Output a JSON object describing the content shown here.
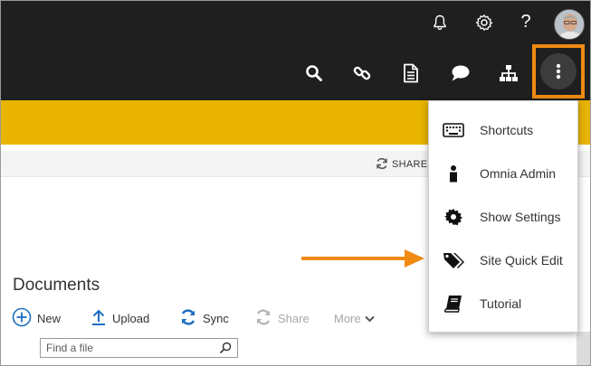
{
  "topbar": {
    "icons_row1": [
      "bell-icon",
      "gear-icon",
      "help-icon",
      "avatar"
    ],
    "help_glyph": "?",
    "icons_row2": [
      "search-icon",
      "link-icon",
      "document-icon",
      "chat-icon",
      "sitemap-icon",
      "more-vertical-icon"
    ]
  },
  "colors": {
    "topbar": "#1f1f1f",
    "brand_band": "#e8b400",
    "highlight": "#f08a13",
    "arrow": "#f08a13",
    "link_blue": "#1e6fc2"
  },
  "commandbar": {
    "share_label": "SHARE"
  },
  "menu": {
    "items": [
      {
        "label": "Shortcuts",
        "icon": "keyboard-icon"
      },
      {
        "label": "Omnia Admin",
        "icon": "person-icon"
      },
      {
        "label": "Show Settings",
        "icon": "gear-icon"
      },
      {
        "label": "Site Quick Edit",
        "icon": "tags-icon"
      },
      {
        "label": "Tutorial",
        "icon": "book-icon"
      }
    ]
  },
  "documents": {
    "title": "Documents",
    "toolbar": {
      "new_label": "New",
      "upload_label": "Upload",
      "sync_label": "Sync",
      "share_label": "Share",
      "more_label": "More"
    },
    "search_placeholder": "Find a file"
  }
}
